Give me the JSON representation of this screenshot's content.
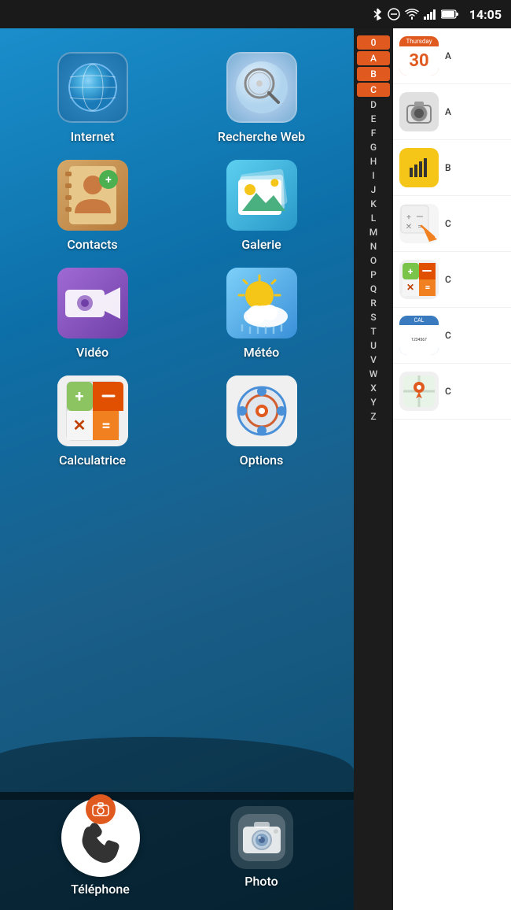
{
  "statusBar": {
    "time": "14:05",
    "icons": [
      "bluetooth",
      "minus-circle",
      "wifi",
      "signal",
      "battery"
    ]
  },
  "homeScreen": {
    "apps": [
      {
        "id": "internet",
        "label": "Internet",
        "icon": "internet"
      },
      {
        "id": "recherche",
        "label": "Recherche Web",
        "icon": "search"
      },
      {
        "id": "contacts",
        "label": "Contacts",
        "icon": "contacts"
      },
      {
        "id": "galerie",
        "label": "Galerie",
        "icon": "gallery"
      },
      {
        "id": "video",
        "label": "Vidéo",
        "icon": "video"
      },
      {
        "id": "meteo",
        "label": "Météo",
        "icon": "meteo"
      },
      {
        "id": "calculatrice",
        "label": "Calculatrice",
        "icon": "calc"
      },
      {
        "id": "options",
        "label": "Options",
        "icon": "options"
      }
    ],
    "dock": [
      {
        "id": "telephone",
        "label": "Téléphone",
        "icon": "phone"
      },
      {
        "id": "photo",
        "label": "Photo",
        "icon": "camera"
      }
    ]
  },
  "alphaIndex": {
    "letters": [
      "0",
      "A",
      "B",
      "C",
      "D",
      "E",
      "F",
      "G",
      "H",
      "I",
      "J",
      "K",
      "L",
      "M",
      "N",
      "O",
      "P",
      "Q",
      "R",
      "S",
      "T",
      "U",
      "V",
      "W",
      "X",
      "Y",
      "Z"
    ],
    "activeLetters": [
      "0",
      "A",
      "B",
      "C"
    ]
  },
  "appList": [
    {
      "id": "calendar",
      "label": "A",
      "color": "#e05a20",
      "bgColor": "#e05a20"
    },
    {
      "id": "camera2",
      "label": "A",
      "color": "#888",
      "bgColor": "#f0f0f0"
    },
    {
      "id": "sim",
      "label": "B",
      "color": "#f5c518",
      "bgColor": "#f5c518"
    },
    {
      "id": "calc2",
      "label": "C",
      "color": "#f0a030",
      "bgColor": "#f0f0f0"
    },
    {
      "id": "calc3",
      "label": "C",
      "color": "#5cb85c",
      "bgColor": "#f0f0f0"
    },
    {
      "id": "calendar2",
      "label": "C",
      "color": "#4a90d9",
      "bgColor": "#4a90d9"
    },
    {
      "id": "maps",
      "label": "C",
      "color": "#5cb85c",
      "bgColor": "#f0f0f0"
    }
  ]
}
